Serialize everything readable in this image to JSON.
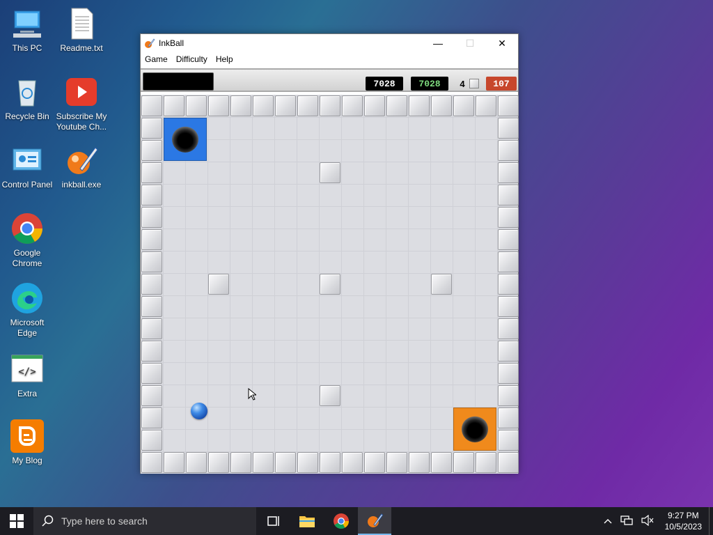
{
  "desktop": {
    "icons": [
      {
        "label": "This PC",
        "icon": "this-pc-icon"
      },
      {
        "label": "Readme.txt",
        "icon": "text-file-icon"
      },
      {
        "label": "Recycle Bin",
        "icon": "recycle-bin-icon"
      },
      {
        "label": "Subscribe My Youtube Ch...",
        "icon": "youtube-icon"
      },
      {
        "label": "Control Panel",
        "icon": "control-panel-icon"
      },
      {
        "label": "inkball.exe",
        "icon": "inkball-icon"
      },
      {
        "label": "Google Chrome",
        "icon": "chrome-icon"
      },
      {
        "label": "Microsoft Edge",
        "icon": "edge-icon"
      },
      {
        "label": "Extra",
        "icon": "code-file-icon"
      },
      {
        "label": "My Blog",
        "icon": "blogger-icon"
      }
    ]
  },
  "window": {
    "title": "InkBall",
    "controls": {
      "minimize": "—",
      "maximize": "☐",
      "close": "✕"
    },
    "menu": [
      "Game",
      "Difficulty",
      "Help"
    ]
  },
  "game": {
    "score": "7028",
    "high_score": "7028",
    "balls_remaining": "4",
    "time": "107",
    "colors": {
      "score_bg": "#000000",
      "high_score_text": "#7fdc7f",
      "time_bg": "#c7472c",
      "blue_hole": "#2b78e4",
      "orange_hole": "#f08a1c"
    }
  },
  "taskbar": {
    "search_placeholder": "Type here to search",
    "time": "9:27 PM",
    "date": "10/5/2023",
    "pinned": [
      "task-view-icon",
      "file-explorer-icon",
      "chrome-icon",
      "inkball-icon"
    ]
  }
}
